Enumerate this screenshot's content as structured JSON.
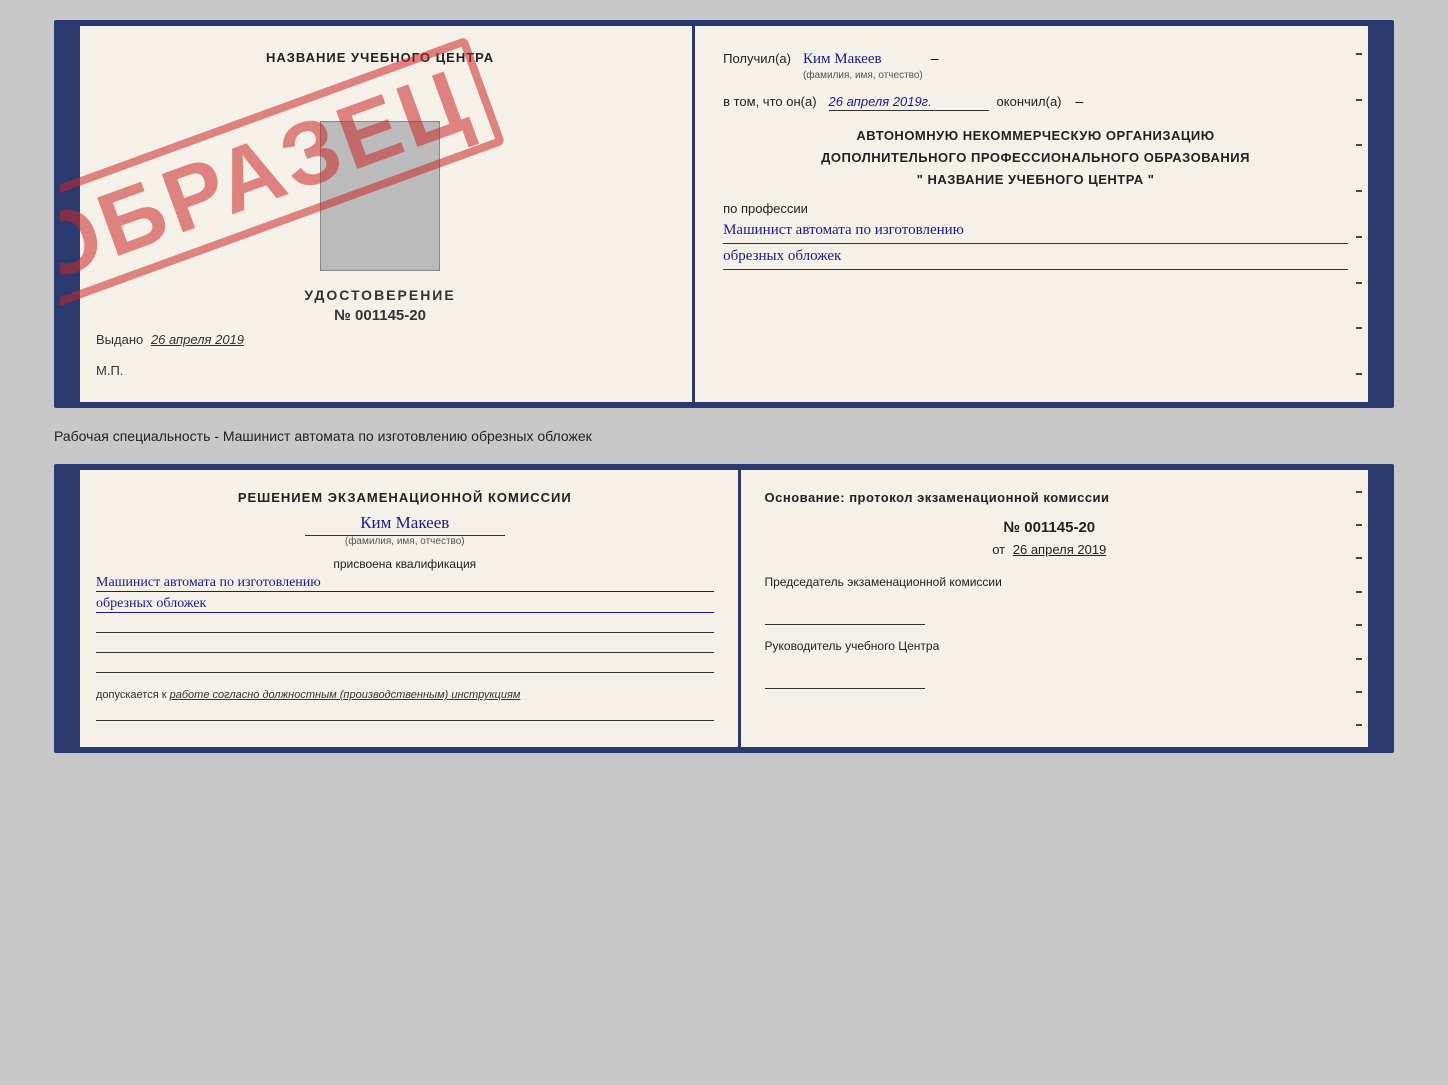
{
  "top_cert": {
    "left": {
      "title": "НАЗВАНИЕ УЧЕБНОГО ЦЕНТРА",
      "stamp_text": "ОБРАЗЕЦ",
      "udostoverenie_label": "УДОСТОВЕРЕНИЕ",
      "number": "№ 001145-20",
      "vydano_label": "Выдано",
      "vydano_date": "26 апреля 2019",
      "mp_label": "М.П."
    },
    "right": {
      "poluchil_label": "Получил(а)",
      "recipient_name": "Ким Макеев",
      "fio_sub": "(фамилия, имя, отчество)",
      "vtom_label": "в том, что он(а)",
      "date_value": "26 апреля 2019г.",
      "okonchil_label": "окончил(а)",
      "center_text_line1": "АВТОНОМНУЮ НЕКОММЕРЧЕСКУЮ ОРГАНИЗАЦИЮ",
      "center_text_line2": "ДОПОЛНИТЕЛЬНОГО ПРОФЕССИОНАЛЬНОГО ОБРАЗОВАНИЯ",
      "center_text_line3": "\" НАЗВАНИЕ УЧЕБНОГО ЦЕНТРА \"",
      "po_professii_label": "по профессии",
      "profession_line1": "Машинист автомата по изготовлению",
      "profession_line2": "обрезных обложек"
    }
  },
  "middle_label": "Рабочая специальность - Машинист автомата по изготовлению обрезных обложек",
  "bottom_cert": {
    "left": {
      "komissia_title": "Решением экзаменационной комиссии",
      "name": "Ким Макеев",
      "fio_sub": "(фамилия, имя, отчество)",
      "prisvoena_label": "присвоена квалификация",
      "profession_line1": "Машинист автомата по изготовлению",
      "profession_line2": "обрезных обложек",
      "dopuskaetsya_prefix": "допускается к",
      "dopuskaetsya_text": "работе согласно должностным (производственным) инструкциям"
    },
    "right": {
      "osnovanie_title": "Основание: протокол экзаменационной комиссии",
      "protocol_num": "№ 001145-20",
      "ot_label": "от",
      "protocol_date": "26 апреля 2019",
      "predsedatel_label": "Председатель экзаменационной комиссии",
      "rukovoditel_label": "Руководитель учебного Центра"
    }
  }
}
